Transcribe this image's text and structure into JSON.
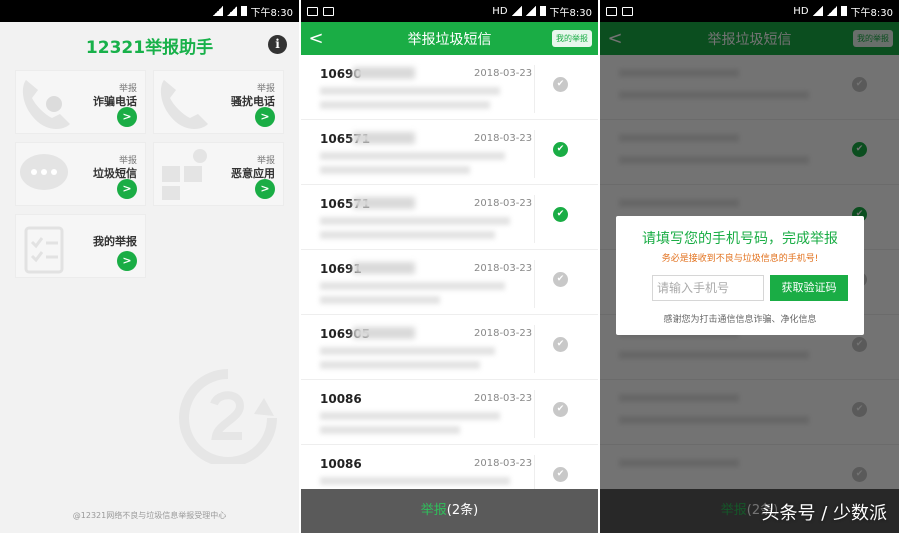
{
  "status": {
    "time": "下午8:30",
    "hd": "HD"
  },
  "home": {
    "title": "12321举报助手",
    "tiles": [
      {
        "tag": "举报",
        "name": "诈骗电话"
      },
      {
        "tag": "举报",
        "name": "骚扰电话"
      },
      {
        "tag": "举报",
        "name": "垃圾短信"
      },
      {
        "tag": "举报",
        "name": "恶意应用"
      },
      {
        "tag": "",
        "name": "我的举报"
      }
    ],
    "footer": "@12321网络不良与垃圾信息举报受理中心"
  },
  "sms": {
    "title": "举报垃圾短信",
    "my_reports": "我的举报",
    "rows": [
      {
        "number": "10690",
        "date": "2018-03-23",
        "checked": false
      },
      {
        "number": "106571",
        "date": "2018-03-23",
        "checked": true
      },
      {
        "number": "106571",
        "date": "2018-03-23",
        "checked": true
      },
      {
        "number": "10691",
        "date": "2018-03-23",
        "checked": false
      },
      {
        "number": "106905",
        "date": "2018-03-23",
        "checked": false
      },
      {
        "number": "10086",
        "date": "2018-03-23",
        "checked": false
      },
      {
        "number": "10086",
        "date": "2018-03-23",
        "checked": false
      }
    ],
    "footer_action": "举报",
    "footer_count": "(2条)"
  },
  "dialog": {
    "title": "请填写您的手机号码，完成举报",
    "subtitle": "务必是接收到不良与垃圾信息的手机号!",
    "phone_placeholder": "请输入手机号",
    "get_code": "获取验证码",
    "note": "感谢您为打击通信信息诈骗、净化信息"
  },
  "brand": "头条号 / 少数派",
  "colors": {
    "accent": "#1aad45",
    "warning": "#e2711d"
  }
}
